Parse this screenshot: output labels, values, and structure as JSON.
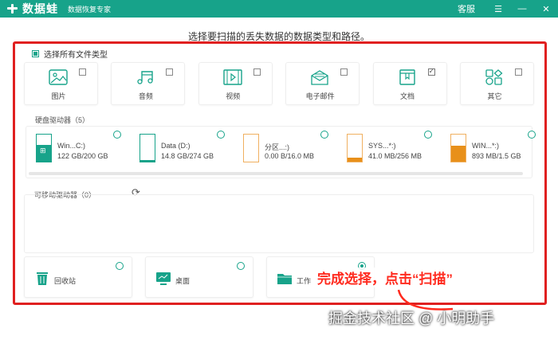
{
  "titlebar": {
    "logo_text": "数据蛙",
    "subtitle": "数据恢复专家",
    "service": "客服",
    "menu": "☰",
    "minimize": "—",
    "close": "✕",
    "accent": "#17a38a"
  },
  "heading": "选择要扫描的丢失数据的数据类型和路径。",
  "select_all": {
    "label": "选择所有文件类型",
    "checked": true
  },
  "file_types": [
    {
      "label": "图片",
      "icon": "image-icon",
      "checked": false
    },
    {
      "label": "音频",
      "icon": "music-icon",
      "checked": false
    },
    {
      "label": "视频",
      "icon": "video-icon",
      "checked": false
    },
    {
      "label": "电子邮件",
      "icon": "email-icon",
      "checked": false
    },
    {
      "label": "文档",
      "icon": "document-icon",
      "checked": true
    },
    {
      "label": "其它",
      "icon": "shapes-icon",
      "checked": false
    }
  ],
  "disk_section": {
    "label": "硬盘驱动器（5）",
    "drives": [
      {
        "name": "Win...C:)",
        "size": "122 GB/200 GB",
        "used_fraction": 0.61,
        "color": "#17a38a",
        "icon": "windows-icon"
      },
      {
        "name": "Data (D:)",
        "size": "14.8 GB/274 GB",
        "used_fraction": 0.05,
        "color": "#17a38a"
      },
      {
        "name": "分区...:)",
        "size": "0.00  B/16.0 MB",
        "used_fraction": 0.0,
        "color": "#f0a040"
      },
      {
        "name": "SYS...*:)",
        "size": "41.0 MB/256 MB",
        "used_fraction": 0.16,
        "color": "#e8901a"
      },
      {
        "name": "WIN...*:)",
        "size": "893 MB/1.5 GB",
        "used_fraction": 0.58,
        "color": "#e8901a"
      }
    ]
  },
  "removable_section": {
    "label": "可移动驱动器（0）",
    "refresh_icon": "refresh-icon"
  },
  "locations": [
    {
      "label": "回收站",
      "icon": "recycle-bin-icon",
      "selected": false
    },
    {
      "label": "桌面",
      "icon": "desktop-icon",
      "selected": false
    },
    {
      "label": "工作",
      "icon": "folder-icon",
      "selected": true
    }
  ],
  "annotation": "完成选择，点击“扫描”",
  "watermark": "掘金技术社区 @ 小明助手",
  "highlight_color": "#e02020"
}
